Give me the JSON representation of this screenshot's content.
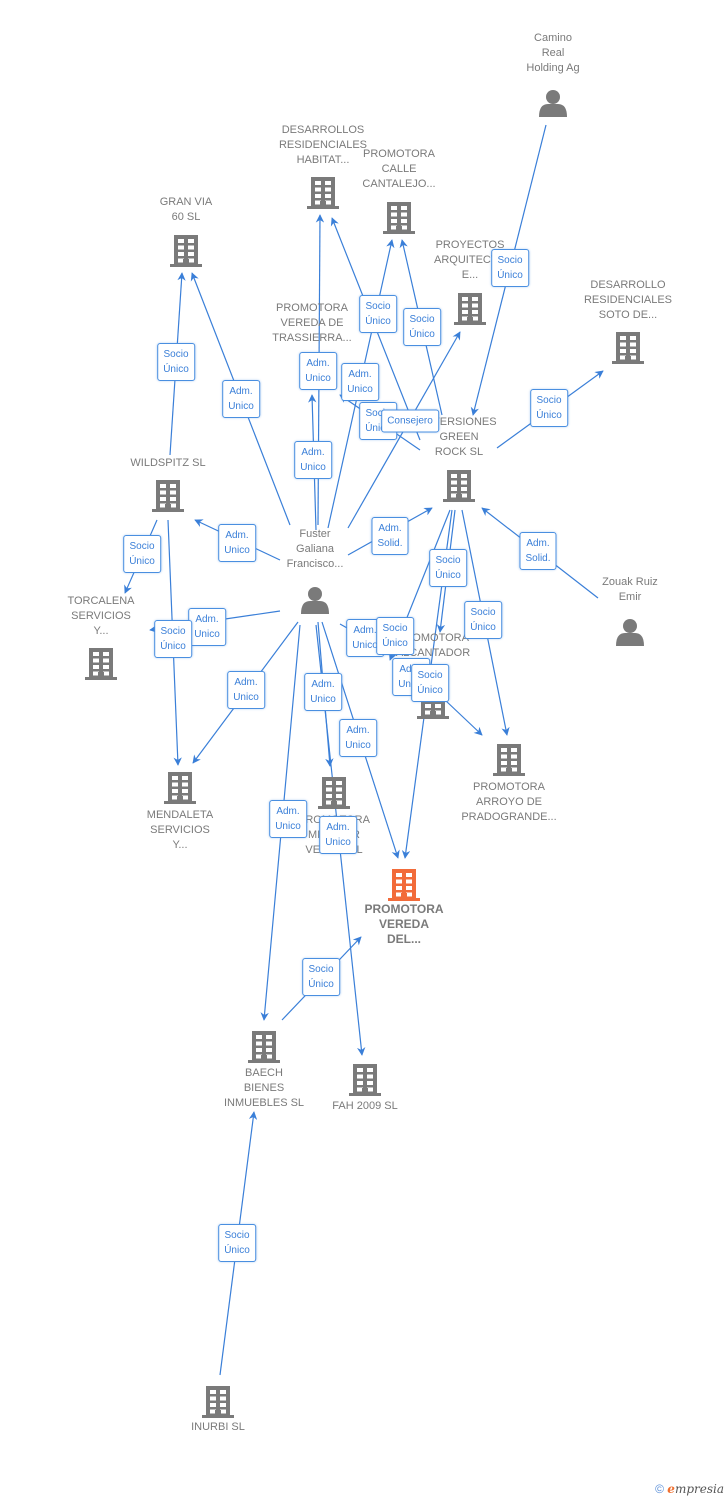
{
  "colors": {
    "edge": "#3a7fd8",
    "node": "#7a7a7a",
    "focus": "#f26b3a"
  },
  "nodes": {
    "camino": {
      "label": [
        "Camino",
        "Real",
        "Holding Ag"
      ],
      "type": "person"
    },
    "desarrollos_habitat": {
      "label": [
        "DESARROLLOS",
        "RESIDENCIALES",
        "HABITAT..."
      ],
      "type": "company"
    },
    "promotora_calle": {
      "label": [
        "PROMOTORA",
        "CALLE",
        "CANTALEJO..."
      ],
      "type": "company"
    },
    "gran_via": {
      "label": [
        "GRAN VIA",
        "60 SL"
      ],
      "type": "company"
    },
    "proyectos": {
      "label": [
        "PROYECTOS",
        "ARQUITECTO",
        "E..."
      ],
      "type": "company"
    },
    "desarrollo_soto": {
      "label": [
        "DESARROLLO",
        "RESIDENCIALES",
        "SOTO DE..."
      ],
      "type": "company"
    },
    "trassierra": {
      "label": [
        "PROMOTORA",
        "VEREDA DE",
        "TRASSIERRA..."
      ],
      "type": "company"
    },
    "green_rock": {
      "label": [
        "INVERSIONES",
        "GREEN",
        "ROCK SL"
      ],
      "type": "company"
    },
    "wildspitz": {
      "label": [
        "WILDSPITZ  SL"
      ],
      "type": "company"
    },
    "fuster": {
      "label": [
        "Fuster",
        "Galiana",
        "Francisco..."
      ],
      "type": "person"
    },
    "zouak": {
      "label": [
        "Zouak Ruiz",
        "Emir"
      ],
      "type": "person"
    },
    "torcalena": {
      "label": [
        "TORCALENA",
        "SERVICIOS",
        "Y..."
      ],
      "type": "company"
    },
    "alcantador": {
      "label": [
        "PROMOTORA",
        "ALCANTADOR"
      ],
      "type": "company"
    },
    "arroyo": {
      "label": [
        "PROMOTORA",
        "ARROYO DE",
        "PRADOGRANDE..."
      ],
      "type": "company"
    },
    "mendaleta": {
      "label": [
        "MENDALETA",
        "SERVICIOS",
        "Y..."
      ],
      "type": "company"
    },
    "veleta": {
      "label": [
        "PROMOTORA",
        "MIRADOR",
        "VELETA SL"
      ],
      "type": "company"
    },
    "main": {
      "label": [
        "PROMOTORA",
        "VEREDA",
        "DEL..."
      ],
      "type": "company",
      "focus": true
    },
    "baech": {
      "label": [
        "BAECH",
        "BIENES",
        "INMUEBLES SL"
      ],
      "type": "company"
    },
    "fah": {
      "label": [
        "FAH 2009 SL"
      ],
      "type": "company"
    },
    "inurbi": {
      "label": [
        "INURBI SL"
      ],
      "type": "company"
    }
  },
  "edges": [
    {
      "from": "camino",
      "to": "green_rock",
      "label": "Socio\nÚnico"
    },
    {
      "from": "fuster",
      "to": "gran_via",
      "label": "Adm.\nUnico"
    },
    {
      "from": "wildspitz",
      "to": "gran_via",
      "label": "Socio\nÚnico"
    },
    {
      "from": "fuster",
      "to": "desarrollos_habitat",
      "label": "Adm.\nUnico"
    },
    {
      "from": "fuster",
      "to": "trassierra",
      "label": "Adm.\nUnico"
    },
    {
      "from": "fuster",
      "to": "promotora_calle",
      "label": "Adm.\nUnico"
    },
    {
      "from": "green_rock",
      "to": "desarrollos_habitat",
      "label": "Socio\nÚnico"
    },
    {
      "from": "green_rock",
      "to": "promotora_calle",
      "label": "Socio\nÚnico"
    },
    {
      "from": "green_rock",
      "to": "trassierra",
      "label": "Socio\nÚnico"
    },
    {
      "from": "fuster",
      "to": "proyectos",
      "label": "Consejero"
    },
    {
      "from": "green_rock",
      "to": "desarrollo_soto",
      "label": "Socio\nÚnico"
    },
    {
      "from": "fuster",
      "to": "wildspitz",
      "label": "Adm.\nUnico"
    },
    {
      "from": "fuster",
      "to": "green_rock",
      "label": "Adm.\nSolid."
    },
    {
      "from": "zouak",
      "to": "green_rock",
      "label": "Adm.\nSolid."
    },
    {
      "from": "wildspitz",
      "to": "torcalena",
      "label": "Socio\nÚnico"
    },
    {
      "from": "fuster",
      "to": "torcalena",
      "label": "Adm.\nUnico"
    },
    {
      "from": "wildspitz",
      "to": "mendaleta",
      "label": "Socio\nÚnico"
    },
    {
      "from": "fuster",
      "to": "mendaleta",
      "label": "Adm.\nUnico"
    },
    {
      "from": "green_rock",
      "to": "alcantador",
      "label": "Socio\nÚnico"
    },
    {
      "from": "green_rock",
      "to": "arroyo",
      "label": "Socio\nÚnico"
    },
    {
      "from": "fuster",
      "to": "alcantador",
      "label": "Adm.\nUnico"
    },
    {
      "from": "green_rock",
      "to": "veleta",
      "label": "Socio\nÚnico"
    },
    {
      "from": "fuster",
      "to": "veleta",
      "label": "Adm.\nUnico"
    },
    {
      "from": "fuster",
      "to": "main",
      "label": "Adm.\nUnico"
    },
    {
      "from": "alcantador",
      "to": "arroyo",
      "label": "Adm.\nUnico"
    },
    {
      "from": "green_rock",
      "to": "main",
      "label": "Socio\nÚnico"
    },
    {
      "from": "fuster",
      "to": "baech",
      "label": "Adm.\nUnico"
    },
    {
      "from": "fuster",
      "to": "fah",
      "label": "Adm.\nUnico"
    },
    {
      "from": "baech",
      "to": "main",
      "label": "Socio\nÚnico"
    },
    {
      "from": "inurbi",
      "to": "baech",
      "label": "Socio\nÚnico"
    }
  ],
  "footer": {
    "copyright": "©",
    "brand_initial": "e",
    "brand_rest": "mpresia"
  }
}
